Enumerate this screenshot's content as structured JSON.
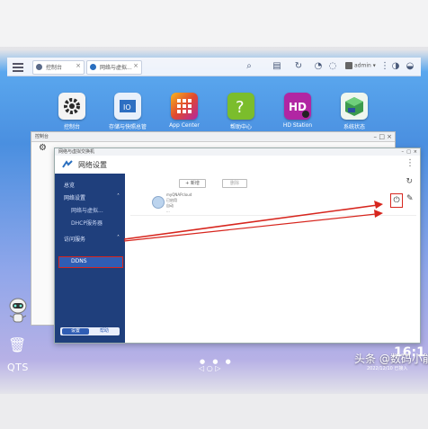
{
  "topbar": {
    "tabs": [
      {
        "label": "控制台",
        "close": "×"
      },
      {
        "label": "网络与虚拟...",
        "close": "×"
      },
      {
        "label": "",
        "close": "×"
      }
    ],
    "user": "admin"
  },
  "apps": [
    {
      "label": "控制台",
      "icon": "gear-icon",
      "color": "#2b2b2b"
    },
    {
      "label": "存储与快照总管",
      "icon": "storage-icon",
      "color": "#2d6fc2"
    },
    {
      "label": "App Center",
      "icon": "grid-icon",
      "color": "#e0492f"
    },
    {
      "label": "帮助中心",
      "icon": "question-icon",
      "color": "#7bbd2c"
    },
    {
      "label": "HD Station",
      "icon": "hd-icon",
      "color": "#b126a3"
    },
    {
      "label": "系统状态",
      "icon": "cube-icon",
      "color": "#2a7b3e"
    }
  ],
  "back_window": {
    "title": "控制台"
  },
  "main_window": {
    "bar_title": "网络与虚拟交换机",
    "title": "网络设置",
    "sidebar": {
      "items": [
        {
          "label": "总览",
          "type": "item"
        },
        {
          "label": "网络设置",
          "type": "group"
        },
        {
          "label": "网络与虚拟...",
          "type": "sub"
        },
        {
          "label": "DHCP服务器",
          "type": "sub"
        },
        {
          "label": "访问服务",
          "type": "group"
        },
        {
          "label": "DDNS",
          "type": "sub"
        }
      ],
      "footer": {
        "left": "设置",
        "right": "帮助"
      }
    },
    "content": {
      "add_button": "+ 新增",
      "delete_button": "删除",
      "row": {
        "lines": [
          "myQNAPcloud",
          "已启用",
          "自动",
          "..."
        ]
      }
    }
  },
  "desktop": {
    "qts_label": "QTS",
    "page_dots": "● ● ●",
    "pager": "◁ ○ ▷"
  },
  "watermark": {
    "text": "头条 @数码小能手",
    "time": "2022/12/10 已接入",
    "big": "16:1"
  }
}
